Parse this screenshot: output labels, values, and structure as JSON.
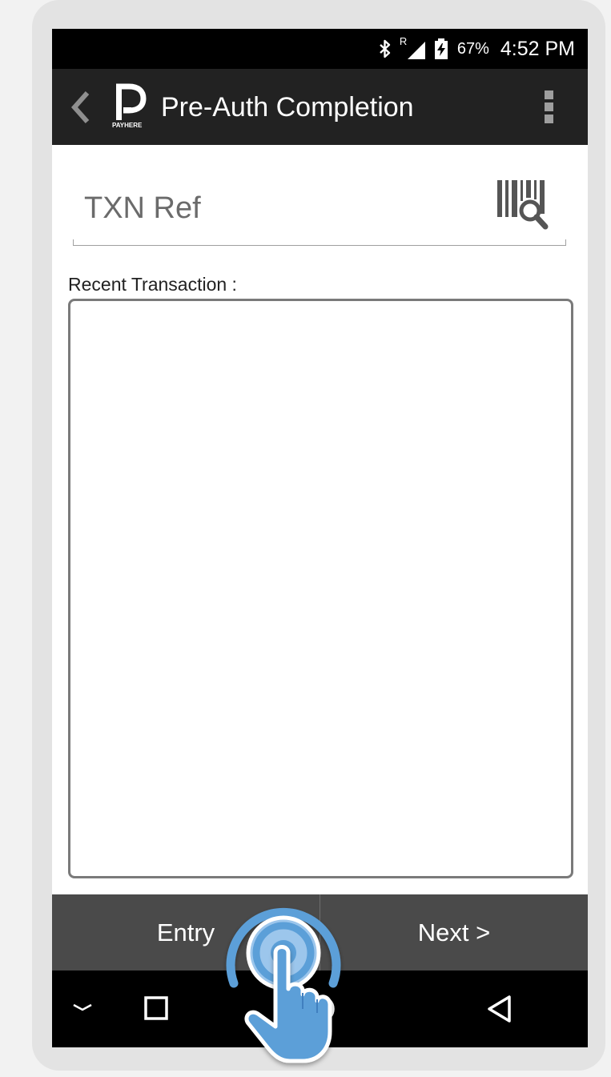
{
  "status_bar": {
    "signal_label": "R",
    "battery_percent": "67%",
    "time": "4:52 PM",
    "icons": [
      "bluetooth-icon",
      "signal-icon",
      "battery-charging-icon"
    ]
  },
  "app_bar": {
    "logo_text": "PAYHERE",
    "title": "Pre-Auth Completion",
    "icons": [
      "back-chevron-icon",
      "overflow-menu-icon"
    ]
  },
  "txn_field": {
    "placeholder": "TXN Ref",
    "value": "",
    "icon": "barcode-search-icon"
  },
  "recent": {
    "label": "Recent Transaction :"
  },
  "actions": {
    "entry_label": "Entry",
    "next_label": "Next >"
  },
  "nav_bar": {
    "icons": [
      "hide-keyboard-icon",
      "recent-apps-icon",
      "home-icon",
      "back-icon"
    ]
  },
  "overlay": {
    "icon": "tap-gesture-hand-icon",
    "color": "#5b9fd8"
  }
}
